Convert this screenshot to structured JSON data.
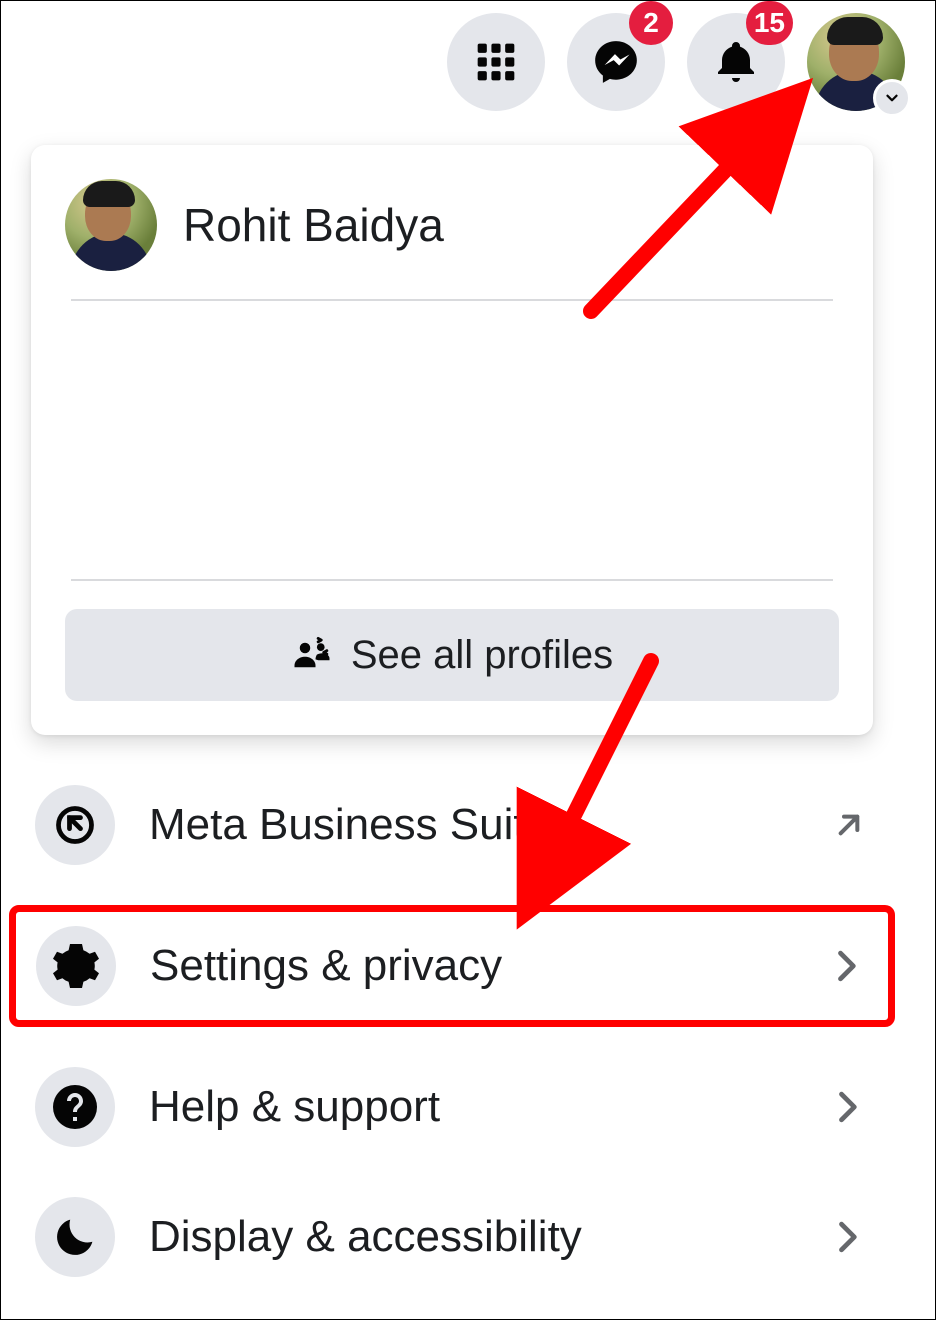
{
  "topbar": {
    "messenger_badge": "2",
    "notifications_badge": "15"
  },
  "profile": {
    "name": "Rohit Baidya",
    "see_all_label": "See all profiles"
  },
  "menu": {
    "items": [
      {
        "label": "Meta Business Suite",
        "icon": "meta-icon",
        "action": "external"
      },
      {
        "label": "Settings & privacy",
        "icon": "gear-icon",
        "action": "submenu"
      },
      {
        "label": "Help & support",
        "icon": "question-icon",
        "action": "submenu"
      },
      {
        "label": "Display & accessibility",
        "icon": "moon-icon",
        "action": "submenu"
      }
    ]
  },
  "colors": {
    "badge": "#e41e3f",
    "highlight": "#ff0000",
    "surface": "#e4e6eb"
  }
}
